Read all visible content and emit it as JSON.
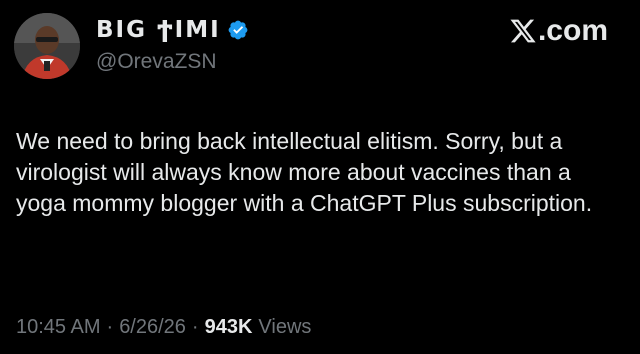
{
  "author": {
    "display_name": "BIG ϮIMI",
    "handle": "@OrevaZSN",
    "verified": true,
    "verified_color": "#1d9bf0"
  },
  "brand": {
    "label": ".com",
    "icon": "x-logo-icon"
  },
  "tweet": {
    "text": "We need to bring back intellectual elitism. Sorry, but a virologist will always know more about vaccines than a yoga mommy blogger with a ChatGPT Plus subscription."
  },
  "meta": {
    "time": "10:45 AM",
    "separator": "·",
    "date": "6/26/26",
    "views_count": "943K",
    "views_label": "Views"
  },
  "colors": {
    "background": "#000000",
    "primary_text": "#e7e9ea",
    "secondary_text": "#71767b"
  }
}
